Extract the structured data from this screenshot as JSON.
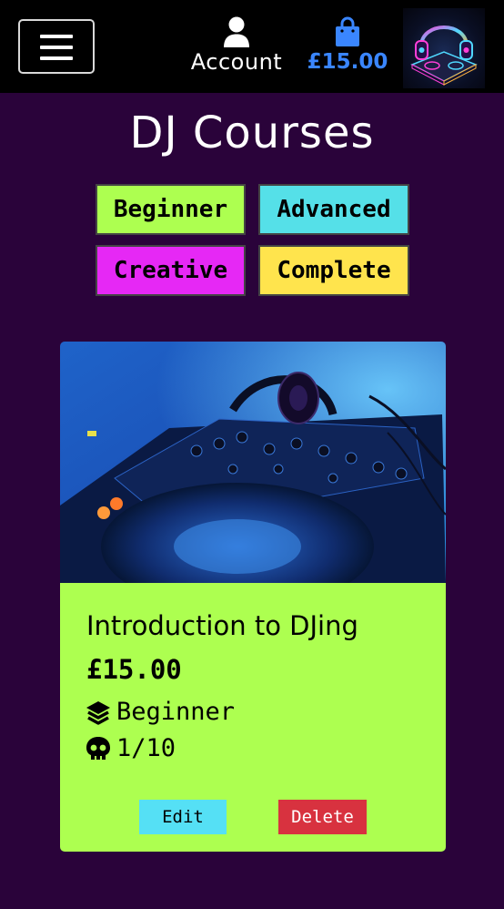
{
  "colors": {
    "page_bg": "#2a033a",
    "navbar_bg": "#000000",
    "bag_blue": "#3a86ff",
    "beginner": "#adff50",
    "advanced": "#55e0e8",
    "creative": "#e628f5",
    "complete": "#ffe44d",
    "card_body": "#adff50",
    "edit_button": "#55e0f5",
    "delete_button": "#d8323f"
  },
  "navbar": {
    "menu_icon": "hamburger-icon",
    "account_icon": "user-icon",
    "account_label": "Account",
    "bag_icon": "shopping-bag-icon",
    "bag_total": "£15.00",
    "logo": "dj-headphones-logo"
  },
  "page": {
    "title": "DJ Courses"
  },
  "categories": [
    {
      "label": "Beginner",
      "color": "#adff50"
    },
    {
      "label": "Advanced",
      "color": "#55e0e8"
    },
    {
      "label": "Creative",
      "color": "#e628f5"
    },
    {
      "label": "Complete",
      "color": "#ffe44d"
    }
  ],
  "course": {
    "image": "dj-deck-with-headphones",
    "title": "Introduction to DJing",
    "price": "£15.00",
    "level_icon": "layer-group-icon",
    "level": "Beginner",
    "difficulty_icon": "skull-icon",
    "difficulty": "1/10",
    "edit_label": "Edit",
    "delete_label": "Delete"
  }
}
